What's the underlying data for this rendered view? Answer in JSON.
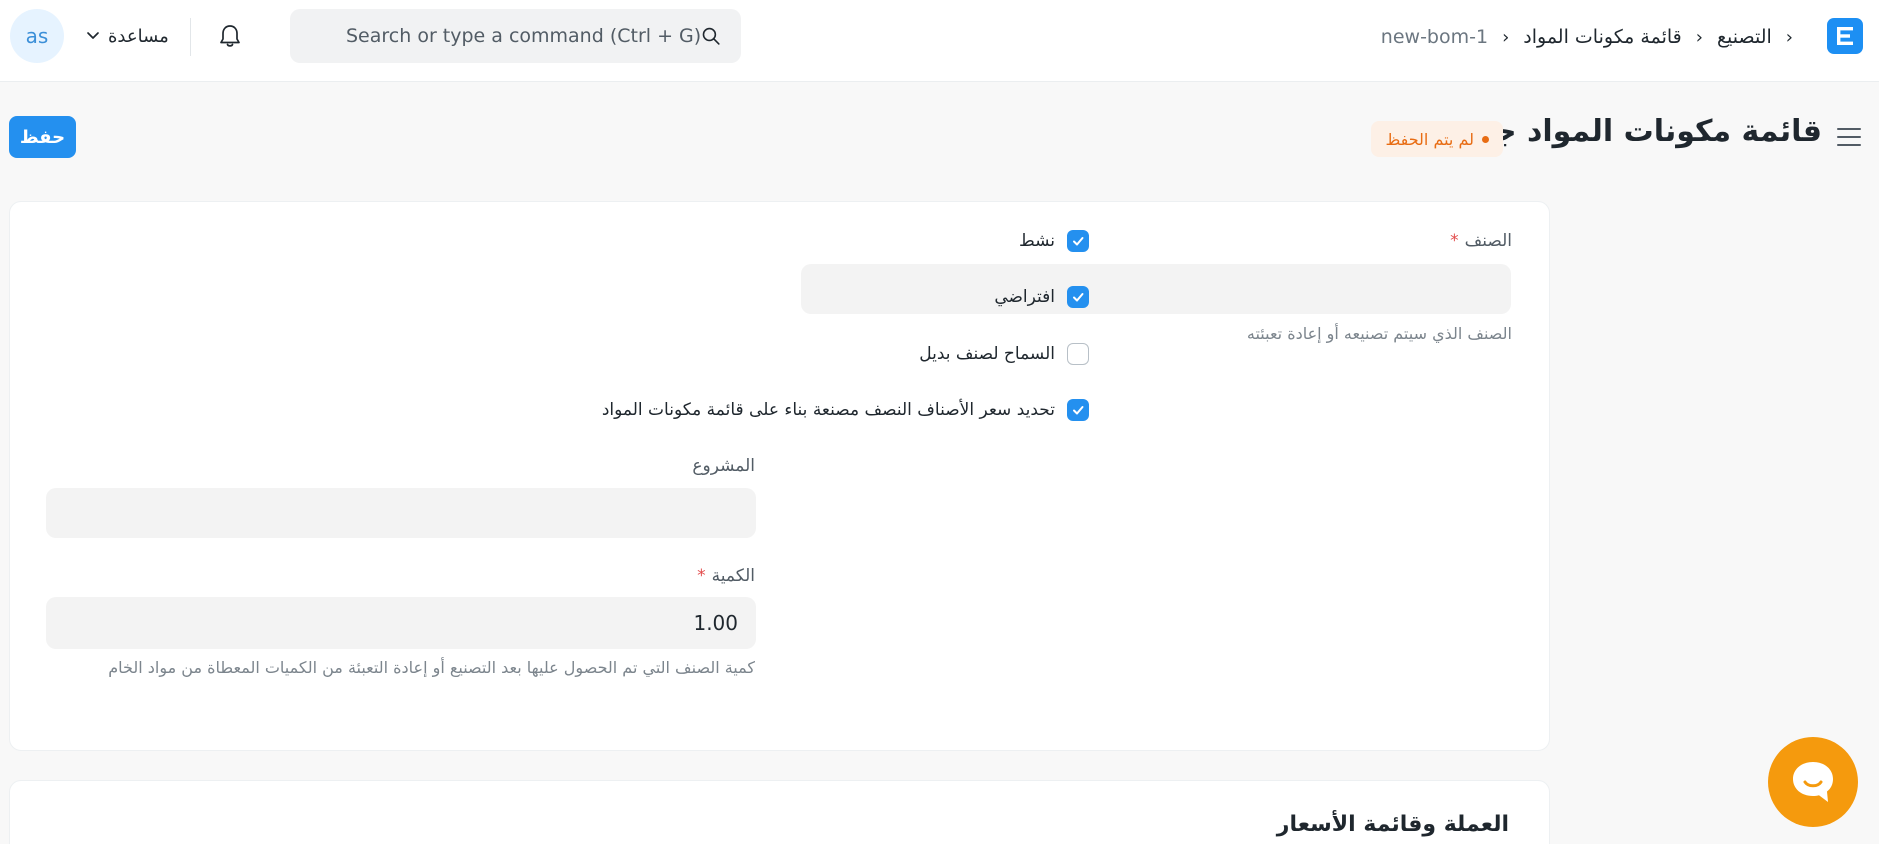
{
  "navbar": {
    "breadcrumbs": [
      "التصنيع",
      "قائمة مكونات المواد",
      "new-bom-1"
    ],
    "search_placeholder": "Search or type a command (Ctrl + G)",
    "help_label": "مساعدة",
    "avatar_initials": "as"
  },
  "page": {
    "title": "قائمة مكونات المواد جديد",
    "status": "لم يتم الحفظ",
    "save_label": "حفظ"
  },
  "form": {
    "item": {
      "label": "الصنف",
      "required_mark": "*",
      "value": "",
      "description": "الصنف الذي سيتم تصنيعه أو إعادة تعبئته"
    },
    "checkboxes": [
      {
        "label": "نشط",
        "checked": true
      },
      {
        "label": "افتراضي",
        "checked": true
      },
      {
        "label": "السماح لصنف بديل",
        "checked": false
      },
      {
        "label": "تحديد سعر الأصناف النصف مصنعة بناء على قائمة مكونات المواد",
        "checked": true
      }
    ],
    "project": {
      "label": "المشروع",
      "value": ""
    },
    "quantity": {
      "label": "الكمية",
      "required_mark": "*",
      "value": "1.00",
      "description": "كمية الصنف التي تم الحصول عليها بعد التصنيع أو إعادة التعبئة من الكميات المعطاة من مواد الخام"
    }
  },
  "sections": {
    "currency_price_list": "العملة وقائمة الأسعار"
  },
  "colors": {
    "primary": "#2490ef",
    "status": "#e86c13",
    "chat": "#f59a0d"
  }
}
